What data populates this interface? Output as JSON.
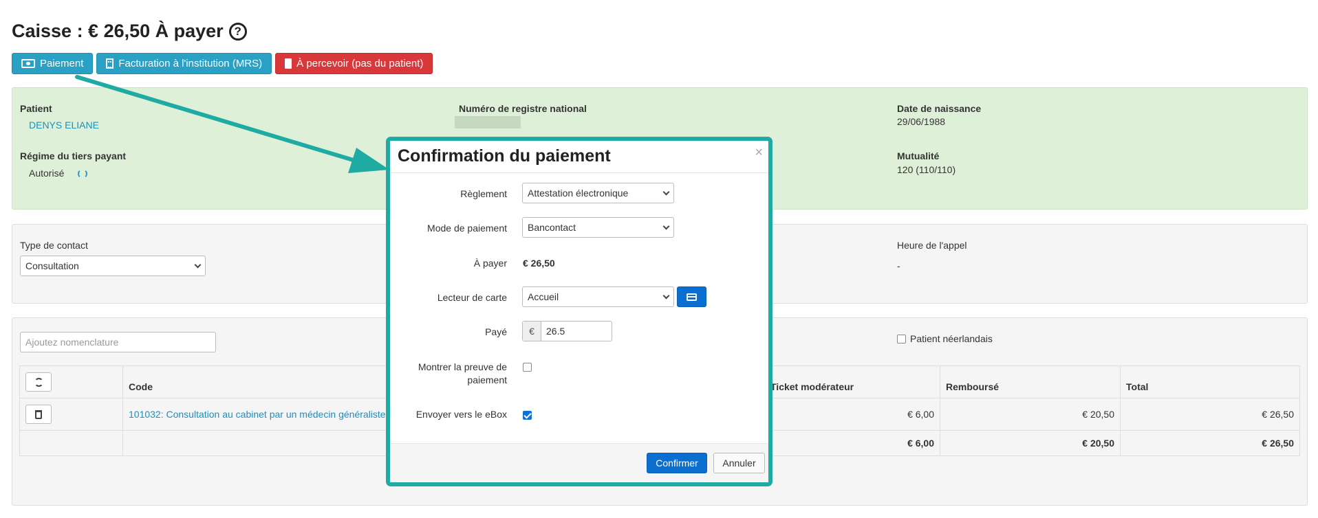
{
  "header": {
    "title": "Caisse : € 26,50 À payer",
    "help_glyph": "?"
  },
  "actions": {
    "payment_label": "Paiement",
    "institution_label": "Facturation à l'institution (MRS)",
    "collect_label": "À percevoir (pas du patient)"
  },
  "patient": {
    "patient_label": "Patient",
    "patient_name": "DENYS ELIANE",
    "nrn_label": "Numéro de registre national",
    "dob_label": "Date de naissance",
    "dob_value": "29/06/1988",
    "tiers_label": "Régime du tiers payant",
    "tiers_value": "Autorisé",
    "mutuality_label": "Mutualité",
    "mutuality_value": "120 (110/110)"
  },
  "contact": {
    "type_label": "Type de contact",
    "type_value": "Consultation",
    "call_time_label": "Heure de l'appel",
    "call_time_value": "-"
  },
  "nomenclature": {
    "placeholder": "Ajoutez nomenclature",
    "dutch_patient_label": "Patient néerlandais",
    "columns": {
      "code": "Code",
      "ticket": "Ticket modérateur",
      "reimbursed": "Remboursé",
      "total": "Total"
    },
    "rows": [
      {
        "code": "101032: Consultation au cabinet par un médecin généraliste",
        "ticket": "€ 6,00",
        "reimbursed": "€ 20,50",
        "total": "€ 26,50"
      }
    ],
    "totals": {
      "ticket": "€ 6,00",
      "reimbursed": "€ 20,50",
      "total": "€ 26,50"
    }
  },
  "modal": {
    "title": "Confirmation du paiement",
    "close_glyph": "×",
    "settlement_label": "Règlement",
    "settlement_value": "Attestation électronique",
    "payment_mode_label": "Mode de paiement",
    "payment_mode_value": "Bancontact",
    "to_pay_label": "À payer",
    "to_pay_value": "€ 26,50",
    "card_reader_label": "Lecteur de carte",
    "card_reader_value": "Accueil",
    "paid_label": "Payé",
    "paid_currency": "€",
    "paid_value": "26.5",
    "proof_label_line1": "Montrer la preuve de",
    "proof_label_line2": "paiement",
    "proof_checked": false,
    "ebox_label": "Envoyer vers le eBox",
    "ebox_checked": true,
    "confirm_label": "Confirmer",
    "cancel_label": "Annuler"
  },
  "colors": {
    "accent_teal": "#1faaa4",
    "button_teal": "#2aa0c4",
    "button_red": "#d9383a",
    "primary_blue": "#0b6fd1",
    "panel_green": "#dff0d8"
  }
}
